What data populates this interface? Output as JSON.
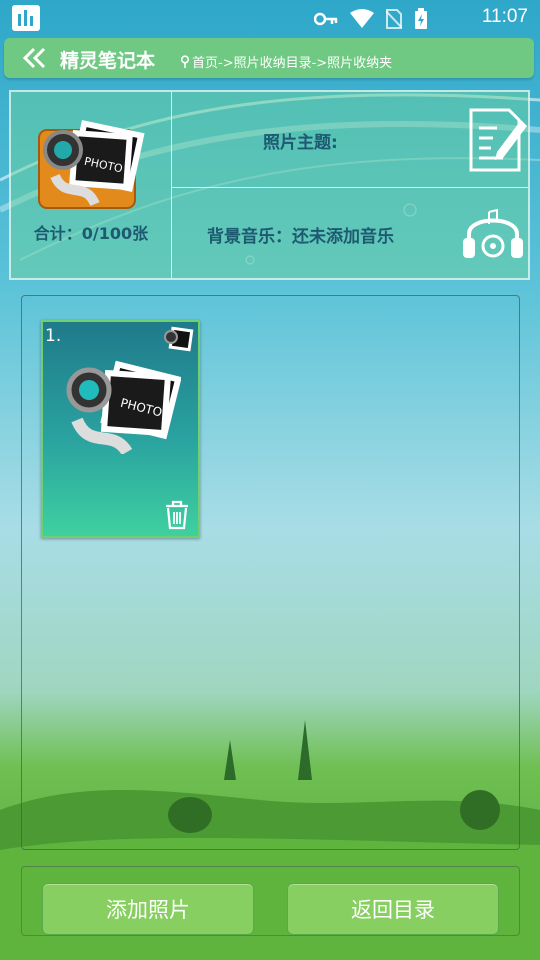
{
  "status_bar": {
    "time": "11:07",
    "icons": [
      "app-notification-icon",
      "key-icon",
      "wifi-icon",
      "no-sim-icon",
      "battery-charging-icon"
    ]
  },
  "title_bar": {
    "title": "精灵笔记本",
    "breadcrumb": "首页->照片收纳目录->照片收纳夹"
  },
  "album_header": {
    "total": "合计：0/100张",
    "photo_theme": "照片主题:",
    "background_music": "背景音乐：还未添加音乐"
  },
  "photos": [
    {
      "index": "1."
    }
  ],
  "buttons": {
    "add_photo": "添加照片",
    "back_to_catalog": "返回目录"
  },
  "colors": {
    "title_bar": "#78cd78",
    "button": "#8cd264",
    "text_dark": "#1d5a70"
  }
}
